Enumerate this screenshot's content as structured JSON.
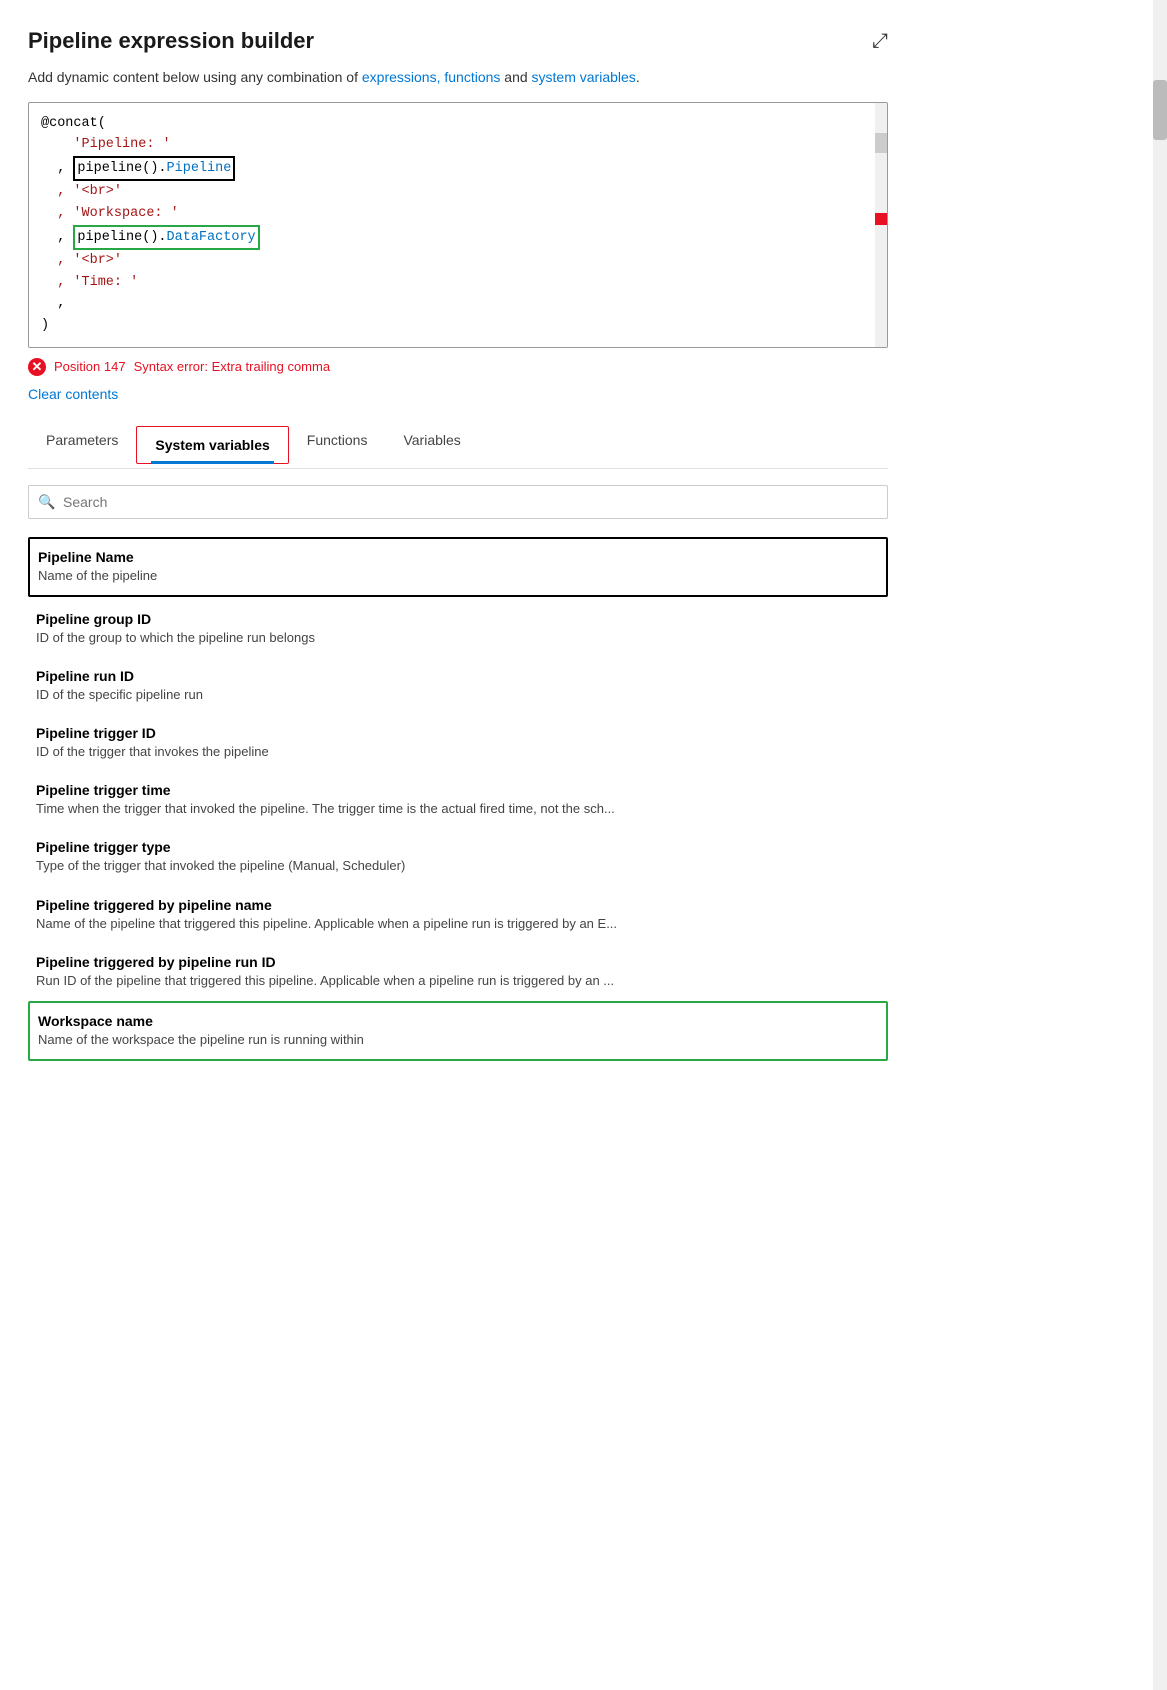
{
  "header": {
    "title": "Pipeline expression builder",
    "expand_icon": "⤢",
    "subtitle_text": "Add dynamic content below using any combination of ",
    "subtitle_link1": "expressions, functions",
    "subtitle_and": " and ",
    "subtitle_link2": "system variables",
    "subtitle_end": "."
  },
  "editor": {
    "code_lines": [
      "@concat(",
      "    'Pipeline: '",
      "  , pipeline().Pipeline",
      "  , '<br>'",
      "  , 'Workspace: '",
      "  , pipeline().DataFactory",
      "  , '<br>'",
      "  , 'Time: '",
      "  ,",
      ")"
    ]
  },
  "error": {
    "position_label": "Position 147",
    "message": "Syntax error: Extra trailing comma"
  },
  "clear_contents_label": "Clear contents",
  "tabs": [
    {
      "id": "parameters",
      "label": "Parameters",
      "active": false
    },
    {
      "id": "system-variables",
      "label": "System variables",
      "active": true
    },
    {
      "id": "functions",
      "label": "Functions",
      "active": false
    },
    {
      "id": "variables",
      "label": "Variables",
      "active": false
    }
  ],
  "search": {
    "placeholder": "Search"
  },
  "variables": [
    {
      "name": "Pipeline Name",
      "description": "Name of the pipeline",
      "highlighted": "black"
    },
    {
      "name": "Pipeline group ID",
      "description": "ID of the group to which the pipeline run belongs",
      "highlighted": "none"
    },
    {
      "name": "Pipeline run ID",
      "description": "ID of the specific pipeline run",
      "highlighted": "none"
    },
    {
      "name": "Pipeline trigger ID",
      "description": "ID of the trigger that invokes the pipeline",
      "highlighted": "none"
    },
    {
      "name": "Pipeline trigger time",
      "description": "Time when the trigger that invoked the pipeline. The trigger time is the actual fired time, not the sch...",
      "highlighted": "none"
    },
    {
      "name": "Pipeline trigger type",
      "description": "Type of the trigger that invoked the pipeline (Manual, Scheduler)",
      "highlighted": "none"
    },
    {
      "name": "Pipeline triggered by pipeline name",
      "description": "Name of the pipeline that triggered this pipeline. Applicable when a pipeline run is triggered by an E...",
      "highlighted": "none"
    },
    {
      "name": "Pipeline triggered by pipeline run ID",
      "description": "Run ID of the pipeline that triggered this pipeline. Applicable when a pipeline run is triggered by an ...",
      "highlighted": "none"
    },
    {
      "name": "Workspace name",
      "description": "Name of the workspace the pipeline run is running within",
      "highlighted": "green"
    }
  ]
}
